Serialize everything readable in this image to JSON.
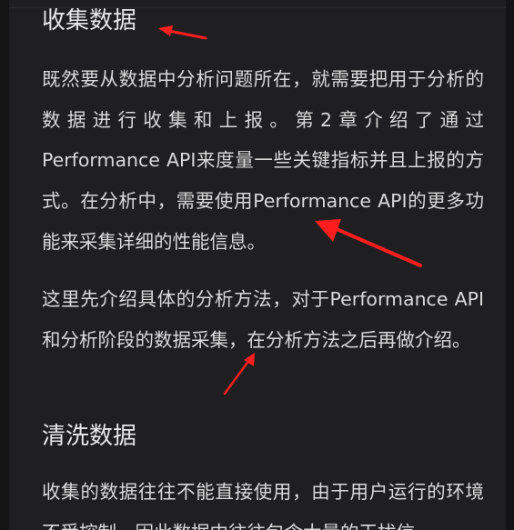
{
  "document": {
    "sections": [
      {
        "heading": "收集数据",
        "paragraphs": [
          "既然要从数据中分析问题所在，就需要把用于分析的数据进行收集和上报。第2章介绍了通过Performance API来度量一些关键指标并且上报的方式。在分析中，需要使用Performance API的更多功能来采集详细的性能信息。",
          "这里先介绍具体的分析方法，对于Performance API和分析阶段的数据采集，在分析方法之后再做介绍。"
        ]
      },
      {
        "heading": "清洗数据",
        "paragraphs": [
          "收集的数据往往不能直接使用，由于用户运行的环境不受控制，因此数据中往往包含大量的干扰信"
        ]
      }
    ]
  },
  "annotations": {
    "arrow_color": "#ff1e1e",
    "arrows": [
      "red-arrow",
      "red-arrow",
      "red-arrow"
    ]
  }
}
